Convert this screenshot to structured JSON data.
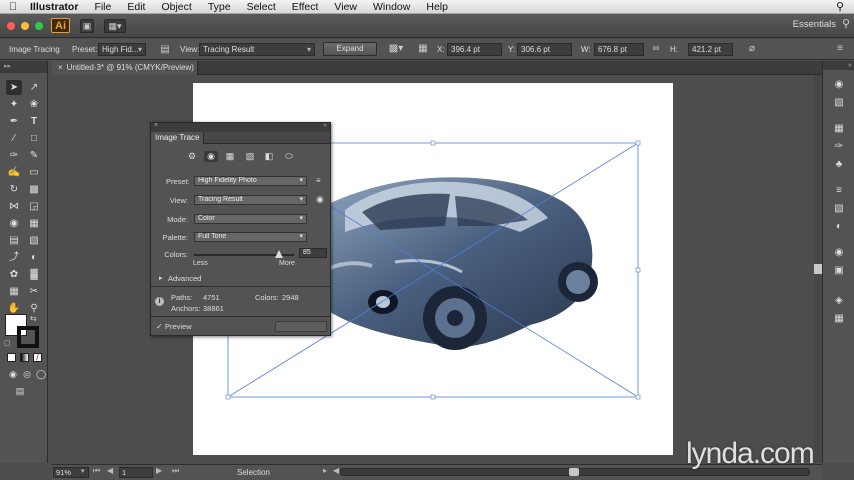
{
  "menubar": {
    "apple_icon": "apple-logo",
    "app_name": "Illustrator",
    "items": [
      "File",
      "Edit",
      "Object",
      "Type",
      "Select",
      "Effect",
      "View",
      "Window",
      "Help"
    ],
    "search_icon": "spotlight-search"
  },
  "appbar": {
    "logo": "Ai",
    "workspace": "Essentials",
    "traffic_colors": [
      "#fc605b",
      "#fdbc40",
      "#34c84a"
    ]
  },
  "controlbar": {
    "panel_label": "Image Tracing",
    "preset_label": "Preset:",
    "preset_value": "High Fid...",
    "view_label": "View:",
    "view_value": "Tracing Result",
    "expand_label": "Expand",
    "x_label": "X:",
    "x_value": "396.4 pt",
    "y_label": "Y:",
    "y_value": "306.6 pt",
    "w_label": "W:",
    "w_value": "676.8 pt",
    "h_label": "H:",
    "h_value": "421.2 pt"
  },
  "document": {
    "tab_title": "Untitled-3* @ 91% (CMYK/Preview)"
  },
  "image_trace_panel": {
    "title": "Image Trace",
    "preset_label": "Preset:",
    "preset_value": "High Fidelity Photo",
    "view_label": "View:",
    "view_value": "Tracing Result",
    "mode_label": "Mode:",
    "mode_value": "Color",
    "palette_label": "Palette:",
    "palette_value": "Full Tone",
    "colors_label": "Colors:",
    "colors_value": "85",
    "colors_level": 0.85,
    "slider_less": "Less",
    "slider_more": "More",
    "advanced_label": "Advanced",
    "paths_label": "Paths:",
    "paths_value": "4751",
    "colors_count_label": "Colors:",
    "colors_count_value": "2948",
    "anchors_label": "Anchors:",
    "anchors_value": "38861",
    "preview_label": "Preview",
    "preview_checked": true
  },
  "statusbar": {
    "zoom": "91%",
    "artboard_number": "1",
    "tool_status": "Selection"
  },
  "watermark": "lynda.com",
  "colors": {
    "panel_bg": "#535353",
    "canvas_bg": "#4d4d4d",
    "selection_blue": "#4f7fd6",
    "ai_orange": "#f59d1e"
  }
}
